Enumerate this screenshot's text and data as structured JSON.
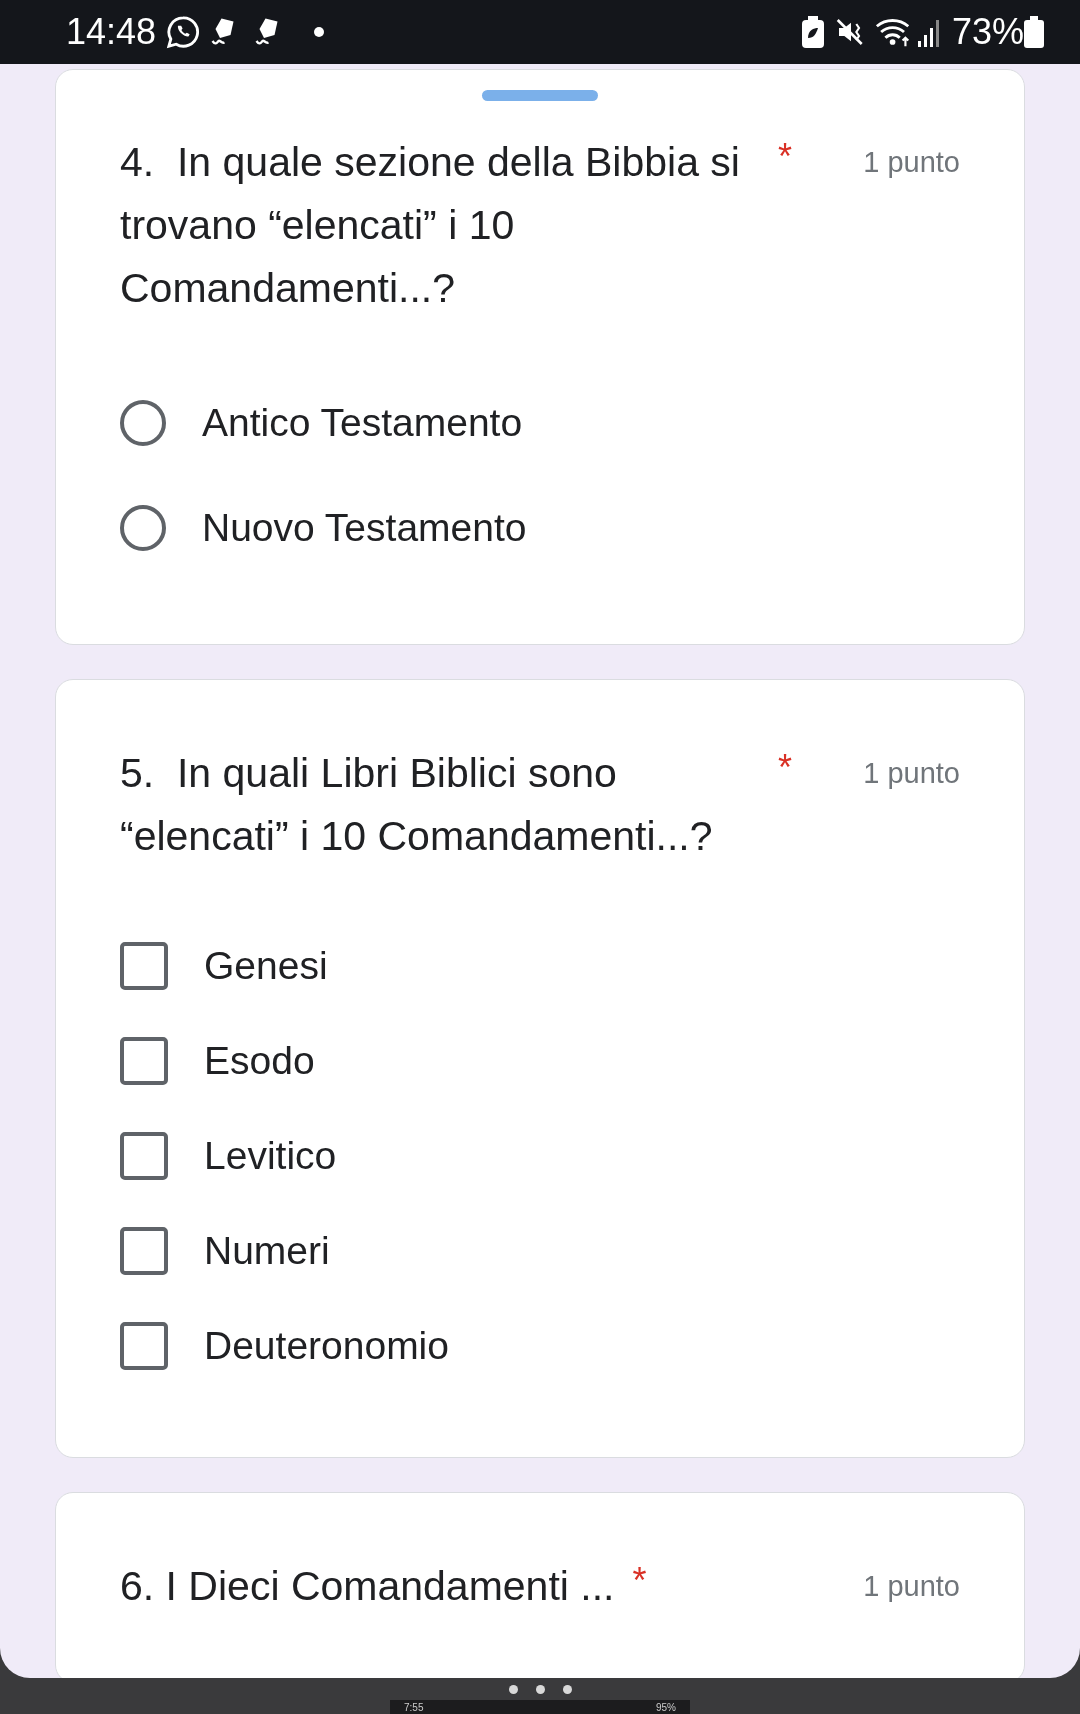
{
  "status_bar": {
    "time": "14:48",
    "battery": "73%"
  },
  "questions": [
    {
      "title": "4.  In quale sezione della Bibbia si trovano “elencati” i 10 Comandamenti...?",
      "required_mark": "*",
      "points": "1 punto",
      "kind": "radio",
      "drag_handle": true,
      "options": [
        {
          "label": "Antico Testamento",
          "selected": false
        },
        {
          "label": "Nuovo Testamento",
          "selected": false
        }
      ]
    },
    {
      "title": "5.  In quali Libri Biblici sono “elencati” i 10 Comandamenti...?",
      "required_mark": "*",
      "points": "1 punto",
      "kind": "checkbox",
      "options": [
        {
          "label": "Genesi",
          "checked": false
        },
        {
          "label": "Esodo",
          "checked": false
        },
        {
          "label": "Levitico",
          "checked": false
        },
        {
          "label": "Numeri",
          "checked": false
        },
        {
          "label": "Deuteronomio",
          "checked": false
        }
      ]
    },
    {
      "title": "6. I Dieci Comandamenti ...",
      "required_mark": "*",
      "points": "1 punto"
    }
  ],
  "mini_status_bar": {
    "time": "7:55",
    "battery": "95%"
  }
}
